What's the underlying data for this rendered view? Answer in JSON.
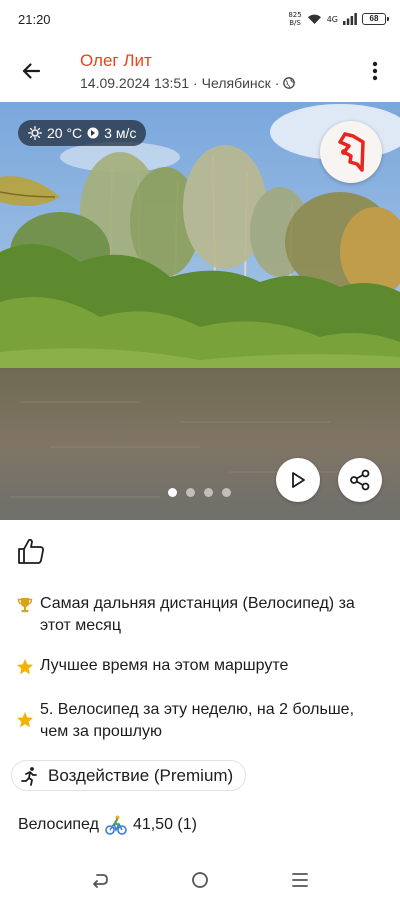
{
  "status_bar": {
    "time": "21:20",
    "speed_value": "825",
    "speed_unit": "B/S",
    "network": "4G",
    "battery": "68"
  },
  "header": {
    "athlete_name": "Олег Лит",
    "date_time": "14.09.2024 13:51",
    "location": "Челябинск"
  },
  "photo": {
    "weather": {
      "temperature": "20 °C",
      "wind": "3 м/с"
    },
    "slide_count": 4,
    "active_slide": 1
  },
  "achievements": [
    {
      "icon": "trophy-icon",
      "text": "Самая дальняя дистанция (Велосипед) за этот месяц"
    },
    {
      "icon": "star-icon",
      "text": "Лучшее время на этом маршруте"
    },
    {
      "icon": "star-icon",
      "text": "5. Велосипед за эту неделю, на 2 больше, чем за прошлую"
    }
  ],
  "impact": {
    "label": "Воздействие (Premium)"
  },
  "sport": {
    "label": "Велосипед",
    "value": "41,50 (1)"
  },
  "colors": {
    "accent": "#e8441f",
    "trophy": "#d9a21b",
    "star": "#f2b400"
  }
}
